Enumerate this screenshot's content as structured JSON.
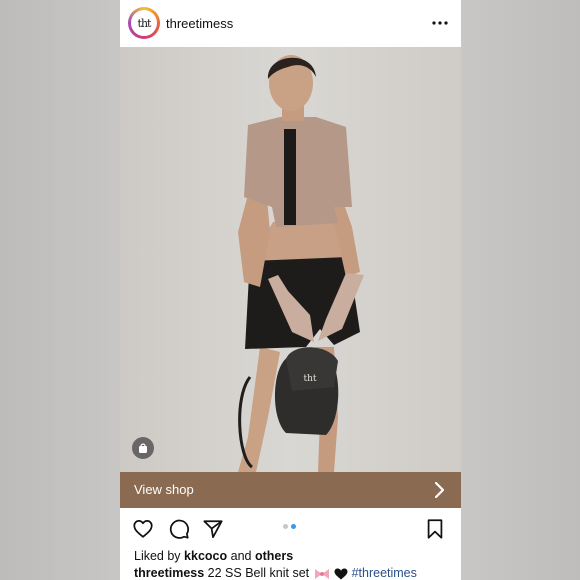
{
  "post": {
    "username": "threetimess",
    "avatar_text": "tht",
    "bag_logo_text": "tht",
    "view_shop_label": "View shop",
    "carousel": {
      "count": 2,
      "active_index": 1
    },
    "likes": {
      "prefix": "Liked by",
      "user": "kkcoco",
      "joiner": "and",
      "others": "others"
    },
    "caption": {
      "username": "threetimess",
      "text": "22 SS Bell knit set",
      "emojis": [
        "ribbon-emoji",
        "black-heart-emoji"
      ],
      "hashtag": "#threetimes"
    }
  },
  "icons": {
    "more": "more-horizontal-icon",
    "shop": "shopping-bag-icon",
    "chevron": "chevron-right-icon",
    "like": "heart-icon",
    "comment": "comment-icon",
    "share": "paper-plane-icon",
    "save": "bookmark-icon"
  },
  "colors": {
    "view_shop_bar": "#8b6a52",
    "hashtag": "#2a4f8a",
    "dot_active": "#3897f0",
    "dot_inactive": "#c7c7c7",
    "photo_bg": "#d2cfcb"
  }
}
